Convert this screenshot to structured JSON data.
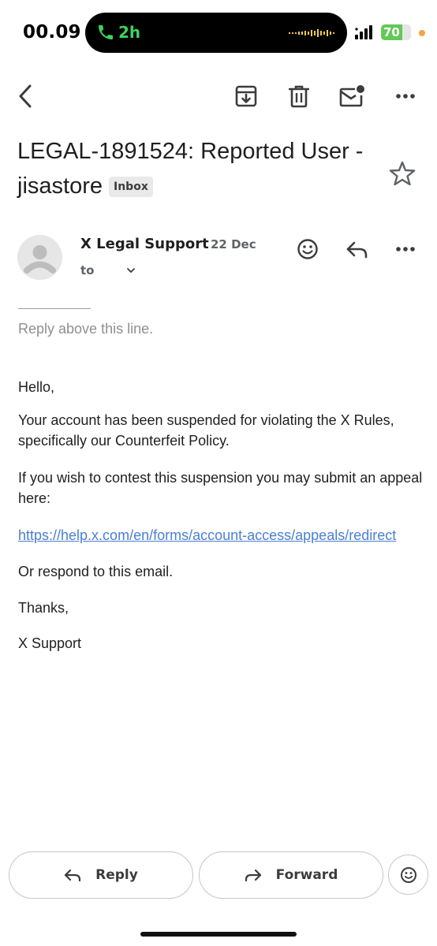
{
  "status_bar": {
    "time": "00.09",
    "call_duration": "2h",
    "battery_level": 70,
    "battery_label": "70",
    "colors": {
      "call_green": "#3fd160",
      "battery_green": "#63c957",
      "charging_dot": "#f4a340"
    }
  },
  "toolbar": {
    "icons": [
      "back-arrow-icon",
      "archive-icon",
      "trash-icon",
      "mark-unread-icon",
      "more-icon"
    ]
  },
  "message": {
    "subject": "LEGAL-1891524: Reported User - jisastore",
    "label": "Inbox",
    "sender_name": "X Legal Support",
    "date": "22 Dec",
    "to_label": "to",
    "separator": "————",
    "reply_above": "Reply above this line.",
    "greeting": "Hello,",
    "paragraph1": "Your account has been suspended for violating the X Rules, specifically our Counterfeit Policy.",
    "paragraph2": "If you wish to contest this suspension you may submit an appeal here:",
    "appeal_link": "https://help.x.com/en/forms/account-access/appeals/redirect",
    "paragraph3": "Or respond to this email.",
    "signoff": "Thanks,",
    "signature": "X Support"
  },
  "actions": {
    "reply_label": "Reply",
    "forward_label": "Forward"
  },
  "colors": {
    "link": "#4a7fd1",
    "text": "#1f1f1f",
    "muted": "#8f8f8f"
  }
}
